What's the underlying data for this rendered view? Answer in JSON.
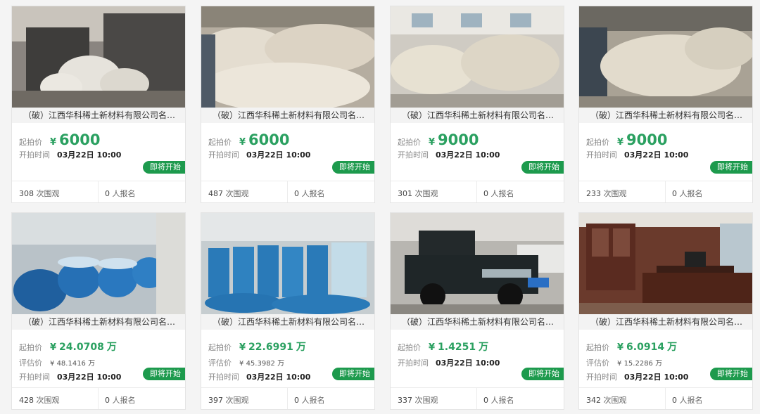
{
  "labels": {
    "start_price": "起拍价",
    "start_time": "开拍时间",
    "valuation": "评估价",
    "badge": "即将开始",
    "views_suffix": "次围观",
    "signups_suffix": "人报名",
    "yen": "¥",
    "wan": "万"
  },
  "colors": {
    "price_green": "#2aa060",
    "badge_green": "#1d9a4d"
  },
  "cards": [
    {
      "title": "（破）江西华科稀土新材料有限公司名…",
      "price": "6000",
      "time": "03月22日 10:00",
      "views": "308",
      "signups": "0",
      "image": "bags-under-tarp"
    },
    {
      "title": "（破）江西华科稀土新材料有限公司名…",
      "price": "6000",
      "time": "03月22日 10:00",
      "views": "487",
      "signups": "0",
      "image": "bag-pile"
    },
    {
      "title": "（破）江西华科稀土新材料有限公司名…",
      "price": "9000",
      "time": "03月22日 10:00",
      "views": "301",
      "signups": "0",
      "image": "warehouse-bags"
    },
    {
      "title": "（破）江西华科稀土新材料有限公司名…",
      "price": "9000",
      "time": "03月22日 10:00",
      "views": "233",
      "signups": "0",
      "image": "bag-heap-tarp"
    },
    {
      "title": "（破）江西华科稀土新材料有限公司名…",
      "price": "24.0708",
      "valuation": "48.1416",
      "time": "03月22日 10:00",
      "views": "428",
      "signups": "0",
      "image": "blue-barrels"
    },
    {
      "title": "（破）江西华科稀土新材料有限公司名…",
      "price": "22.6991",
      "valuation": "45.3982",
      "time": "03月22日 10:00",
      "views": "397",
      "signups": "0",
      "image": "blue-barrels-warehouse"
    },
    {
      "title": "（破）江西华科稀土新材料有限公司名…",
      "price": "1.4251",
      "time": "03月22日 10:00",
      "views": "337",
      "signups": "0",
      "image": "pickup-truck"
    },
    {
      "title": "（破）江西华科稀土新材料有限公司名…",
      "price": "6.0914",
      "valuation": "15.2286",
      "time": "03月22日 10:00",
      "views": "342",
      "signups": "0",
      "image": "office-furniture"
    }
  ]
}
